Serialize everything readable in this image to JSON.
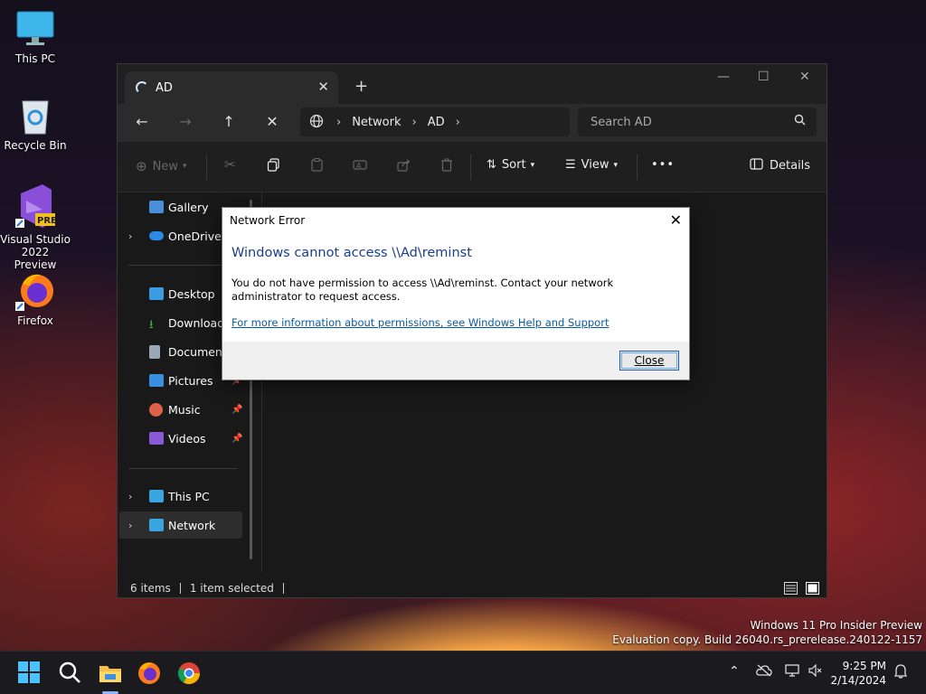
{
  "desktop": {
    "icons": [
      {
        "label": "This PC"
      },
      {
        "label": "Recycle Bin"
      },
      {
        "label": "Visual Studio\n2022 Preview",
        "badge": "PRE"
      },
      {
        "label": "Firefox"
      }
    ]
  },
  "explorer": {
    "tab_title": "AD",
    "tab_close": "✕",
    "new_tab": "+",
    "window_controls": {
      "minimize": "—",
      "maximize": "☐",
      "close": "✕"
    },
    "nav": {
      "back": "←",
      "forward": "→",
      "up": "↑",
      "stop": "✕"
    },
    "address": {
      "crumbs": [
        "Network",
        "AD"
      ],
      "separator": "›"
    },
    "search": {
      "placeholder": "Search AD"
    },
    "toolbar": {
      "new_label": "New",
      "sort_label": "Sort",
      "view_label": "View",
      "more_label": "•••",
      "details_label": "Details"
    },
    "sidebar": [
      {
        "label": "Gallery",
        "icon": "gallery-icon",
        "color": "#4a90d9"
      },
      {
        "label": "OneDrive",
        "icon": "onedrive-icon",
        "color": "#2b8ae6",
        "expandable": true
      },
      {
        "label": "Desktop",
        "icon": "desktop-icon",
        "color": "#3b9be3"
      },
      {
        "label": "Downloads",
        "icon": "downloads-icon",
        "color": "#3fb35a"
      },
      {
        "label": "Documents",
        "icon": "documents-icon",
        "color": "#9aa7b5"
      },
      {
        "label": "Pictures",
        "icon": "pictures-icon",
        "color": "#3a8fe0"
      },
      {
        "label": "Music",
        "icon": "music-icon",
        "color": "#e0614a"
      },
      {
        "label": "Videos",
        "icon": "videos-icon",
        "color": "#8a5ad6"
      },
      {
        "label": "This PC",
        "icon": "computer-icon",
        "color": "#3aa6e0",
        "expandable": true
      },
      {
        "label": "Network",
        "icon": "network-icon",
        "color": "#3aa6e0",
        "expandable": true,
        "selected": true
      }
    ],
    "status": {
      "items": "6 items",
      "selected": "1 item selected"
    }
  },
  "dialog": {
    "title": "Network Error",
    "close": "✕",
    "heading": "Windows cannot access \\\\Ad\\reminst",
    "message": "You do not have permission to access \\\\Ad\\reminst. Contact your network administrator to request access.",
    "link": "For more information about permissions, see Windows Help and Support",
    "button": "Close"
  },
  "watermark": {
    "line1": "Windows 11 Pro Insider Preview",
    "line2": "Evaluation copy. Build 26040.rs_prerelease.240122-1157"
  },
  "taskbar": {
    "time": "9:25 PM",
    "date": "2/14/2024"
  }
}
